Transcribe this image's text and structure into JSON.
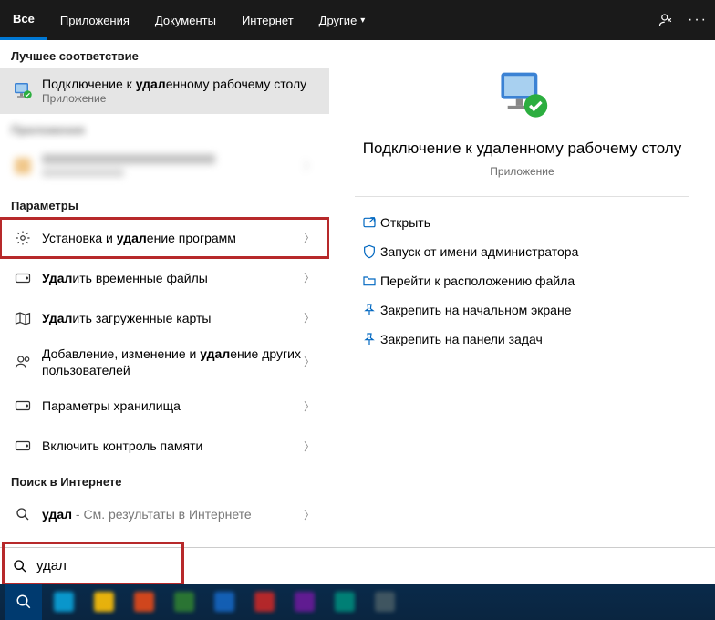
{
  "topbar": {
    "tabs": [
      {
        "label": "Все",
        "active": true
      },
      {
        "label": "Приложения",
        "active": false
      },
      {
        "label": "Документы",
        "active": false
      },
      {
        "label": "Интернет",
        "active": false
      },
      {
        "label": "Другие",
        "active": false,
        "dropdown": true
      }
    ]
  },
  "sections": {
    "best_match": "Лучшее соответствие",
    "apps": "Приложения",
    "params": "Параметры",
    "web": "Поиск в Интернете"
  },
  "best": {
    "title_pre": "Подключение к ",
    "title_bold": "удал",
    "title_post": "енному рабочему столу",
    "sub": "Приложение"
  },
  "params_items": [
    {
      "pre": "Установка и ",
      "bold": "удал",
      "post": "ение программ"
    },
    {
      "pre": "",
      "bold": "Удал",
      "post": "ить временные файлы"
    },
    {
      "pre": "",
      "bold": "Удал",
      "post": "ить загруженные карты"
    },
    {
      "pre": "Добавление, изменение и ",
      "bold": "удал",
      "post": "ение других пользователей"
    },
    {
      "pre": "Параметры хранилища",
      "bold": "",
      "post": ""
    },
    {
      "pre": "Включить контроль памяти",
      "bold": "",
      "post": ""
    }
  ],
  "web": {
    "query": "удал",
    "hint": " - См. результаты в Интернете"
  },
  "detail": {
    "title": "Подключение к удаленному рабочему столу",
    "category": "Приложение",
    "actions": {
      "open": "Открыть",
      "run_admin": "Запуск от имени администратора",
      "open_location": "Перейти к расположению файла",
      "pin_start": "Закрепить на начальном экране",
      "pin_taskbar": "Закрепить на панели задач"
    }
  },
  "search_query": "удал"
}
